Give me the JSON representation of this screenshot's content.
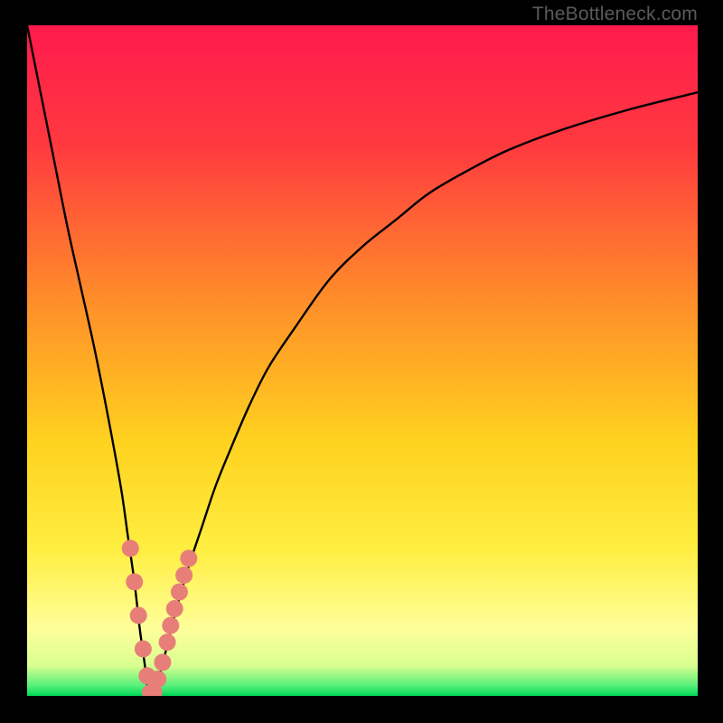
{
  "attribution": "TheBottleneck.com",
  "colors": {
    "bg_black": "#000000",
    "grad_top": "#ff1a4d",
    "grad_mid1": "#ff6a2f",
    "grad_mid2": "#ffd21f",
    "grad_yellow": "#ffee40",
    "grad_paleyellow": "#ffff9a",
    "grad_green": "#00e05b",
    "curve": "#000000",
    "marker_fill": "#e77f78",
    "marker_stroke": "#c96058"
  },
  "chart_data": {
    "type": "line",
    "title": "",
    "xlabel": "",
    "ylabel": "",
    "xlim": [
      0,
      100
    ],
    "ylim": [
      0,
      100
    ],
    "series": [
      {
        "name": "bottleneck-curve",
        "x": [
          0,
          2,
          4,
          6,
          8,
          10,
          12,
          14,
          15,
          16,
          16.8,
          17.5,
          18,
          18.5,
          19,
          20,
          21,
          22,
          24,
          26,
          28,
          30,
          33,
          36,
          40,
          45,
          50,
          55,
          60,
          66,
          72,
          80,
          90,
          100
        ],
        "y": [
          100,
          90,
          80,
          70,
          61,
          52,
          42,
          31,
          24,
          17,
          10,
          5,
          1,
          0,
          1,
          4,
          8,
          12,
          19,
          25,
          31,
          36,
          43,
          49,
          55,
          62,
          67,
          71,
          75,
          78.5,
          81.5,
          84.5,
          87.5,
          90
        ]
      }
    ],
    "markers": {
      "name": "highlight-points",
      "x": [
        15.4,
        16.0,
        16.6,
        17.3,
        17.9,
        18.4,
        18.9,
        19.5,
        20.2,
        20.9,
        21.4,
        22.0,
        22.7,
        23.4,
        24.1
      ],
      "y": [
        22.0,
        17.0,
        12.0,
        7.0,
        3.0,
        0.5,
        0.5,
        2.5,
        5.0,
        8.0,
        10.5,
        13.0,
        15.5,
        18.0,
        20.5
      ]
    },
    "gradient_stops": [
      {
        "offset": 0.0,
        "color": "#ff1a4d"
      },
      {
        "offset": 0.18,
        "color": "#ff3a3f"
      },
      {
        "offset": 0.4,
        "color": "#ff8a2a"
      },
      {
        "offset": 0.62,
        "color": "#ffd21f"
      },
      {
        "offset": 0.78,
        "color": "#ffee40"
      },
      {
        "offset": 0.9,
        "color": "#ffff9a"
      },
      {
        "offset": 0.955,
        "color": "#d9ff90"
      },
      {
        "offset": 0.985,
        "color": "#55f07a"
      },
      {
        "offset": 1.0,
        "color": "#00d858"
      }
    ]
  }
}
